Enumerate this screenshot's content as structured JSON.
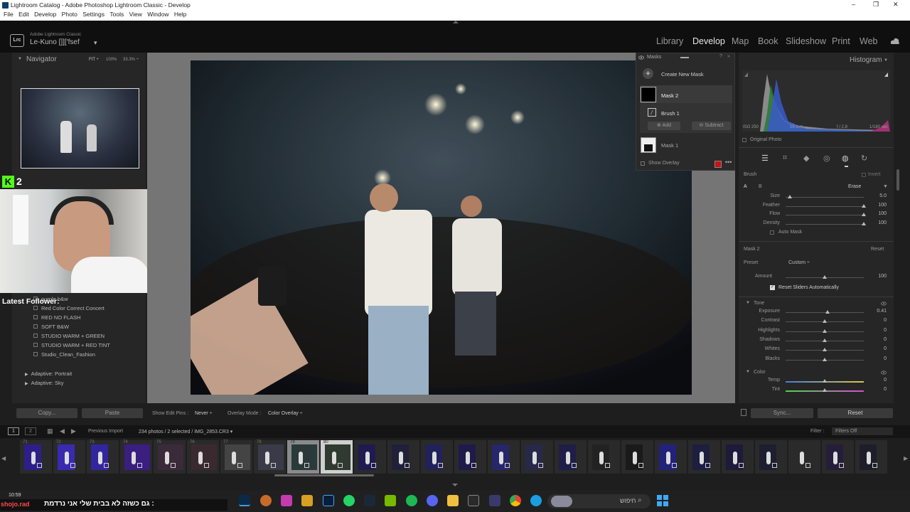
{
  "window": {
    "title": "Lightroom Catalog - Adobe Photoshop Lightroom Classic - Develop",
    "minimize": "–",
    "maximize": "❐",
    "close": "✕"
  },
  "menu": [
    "File",
    "Edit",
    "Develop",
    "Photo",
    "Settings",
    "Tools",
    "View",
    "Window",
    "Help"
  ],
  "identity": {
    "logo": "Lrc",
    "product": "Adobe Lightroom Classic",
    "user": "Le-Kuno []]['fsef",
    "arrow": "▾"
  },
  "modules": [
    "Library",
    "Develop",
    "Map",
    "Book",
    "Slideshow",
    "Print",
    "Web"
  ],
  "active_module": "Develop",
  "navigator": {
    "title": "Navigator",
    "fit": "FIT ÷",
    "z1": "100%",
    "z2": "33.3% ÷"
  },
  "overlay": {
    "kick_badge": "K",
    "viewers": "2",
    "latest_follower": "Latest Follower:"
  },
  "presets": [
    "purple b&w",
    "Red Color Correct Concert",
    "RED NO FLASH",
    "SOFT B&W",
    "STUDIO WARM + GREEN",
    "STUDIO WARM + RED TINT",
    "Studio_Clean_Fashion"
  ],
  "preset_groups": [
    "Adaptive: Portrait",
    "Adaptive: Sky"
  ],
  "left_buttons": {
    "copy": "Copy...",
    "paste": "Paste"
  },
  "toolbar": {
    "show_edit_pins": "Show Edit Pins :",
    "pins_value": "Never ÷",
    "overlay_mode": "Overlay Mode :",
    "overlay_value": "Color Overlay ÷"
  },
  "masks": {
    "title": "Masks",
    "create": "Create New Mask",
    "mask2": "Mask 2",
    "brush1": "Brush 1",
    "add": "Add",
    "subtract": "Subtract",
    "mask1": "Mask 1",
    "show_overlay": "Show Overlay",
    "overlay_color": "#cc1111"
  },
  "histogram": {
    "title": "Histogram",
    "iso": "ISO 250",
    "focal": "15 mm",
    "aperture": "f / 2.8",
    "shutter": "1/180 sec",
    "original_photo": "Original Photo"
  },
  "brush": {
    "label": "Brush",
    "invert": "Invert",
    "a": "A",
    "b": "B",
    "erase": "Erase",
    "sliders": [
      {
        "label": "Size",
        "value": "5.0",
        "pos": 0.05
      },
      {
        "label": "Feather",
        "value": "100",
        "pos": 1.0
      },
      {
        "label": "Flow",
        "value": "100",
        "pos": 1.0
      },
      {
        "label": "Density",
        "value": "100",
        "pos": 1.0
      }
    ],
    "auto_mask": "Auto Mask"
  },
  "mask2_panel": {
    "title": "Mask 2",
    "reset": "Reset",
    "preset_label": "Preset",
    "preset_value": "Custom ÷",
    "amount_label": "Amount",
    "amount_value": "100",
    "amount_pos": 0.5,
    "reset_sliders": "Reset Sliders Automatically"
  },
  "tone": {
    "title": "Tone",
    "sliders": [
      {
        "label": "Exposure",
        "value": "0.41",
        "pos": 0.54
      },
      {
        "label": "Contrast",
        "value": "0",
        "pos": 0.5
      },
      {
        "label": "Highlights",
        "value": "0",
        "pos": 0.5
      },
      {
        "label": "Shadows",
        "value": "0",
        "pos": 0.5
      },
      {
        "label": "Whites",
        "value": "0",
        "pos": 0.5
      },
      {
        "label": "Blacks",
        "value": "0",
        "pos": 0.5
      }
    ]
  },
  "color": {
    "title": "Color",
    "sliders": [
      {
        "label": "Temp",
        "value": "0",
        "pos": 0.5
      },
      {
        "label": "Tint",
        "value": "0",
        "pos": 0.5
      }
    ]
  },
  "right_buttons": {
    "sync": "Sync...",
    "reset": "Reset"
  },
  "filmstrip": {
    "screen1": "1",
    "screen2": "2",
    "source": "Previous Import",
    "count": "234 photos / 2 selected / IMG_2853.CR3 ▾",
    "filter_label": "Filter :",
    "filter_value": "Filters Off"
  },
  "frame_numbers": [
    "71",
    "72",
    "73",
    "74",
    "75",
    "76",
    "77",
    "78",
    "79",
    "80"
  ],
  "taskbar": {
    "time": "10:59",
    "ticker": "גם כשזה לא בבית שלי אני נרדמת :",
    "ticker_user": "shojo.rad",
    "search": "חיפוש"
  }
}
